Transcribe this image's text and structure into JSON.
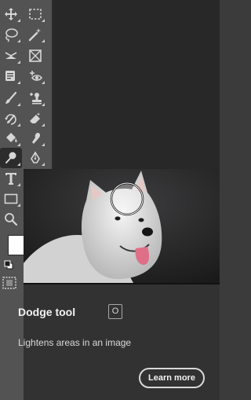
{
  "toolbar": {
    "tools": [
      {
        "icon": "move-icon"
      },
      {
        "icon": "rectangular-marquee-icon"
      },
      {
        "icon": "lasso-icon"
      },
      {
        "icon": "magic-wand-icon"
      },
      {
        "icon": "crop-icon"
      },
      {
        "icon": "frame-icon"
      },
      {
        "icon": "eyedropper-icon"
      },
      {
        "icon": "red-eye-icon"
      },
      {
        "icon": "healing-brush-icon"
      },
      {
        "icon": "clone-stamp-icon"
      },
      {
        "icon": "history-brush-icon"
      },
      {
        "icon": "eraser-icon"
      },
      {
        "icon": "paint-bucket-icon"
      },
      {
        "icon": "smudge-icon"
      },
      {
        "icon": "dodge-icon"
      },
      {
        "icon": "pen-icon"
      },
      {
        "icon": "type-icon"
      },
      {
        "icon": "rectangle-shape-icon"
      },
      {
        "icon": "zoom-icon"
      }
    ],
    "foreground_color": "#ffffff"
  },
  "tooltip": {
    "title": "Dodge tool",
    "shortcut": "O",
    "description": "Lightens areas in an image",
    "learn_more": "Learn more"
  },
  "colors": {
    "toolbar_bg": "#535353",
    "tooltip_bg": "#323232",
    "canvas_bg": "#282828"
  }
}
